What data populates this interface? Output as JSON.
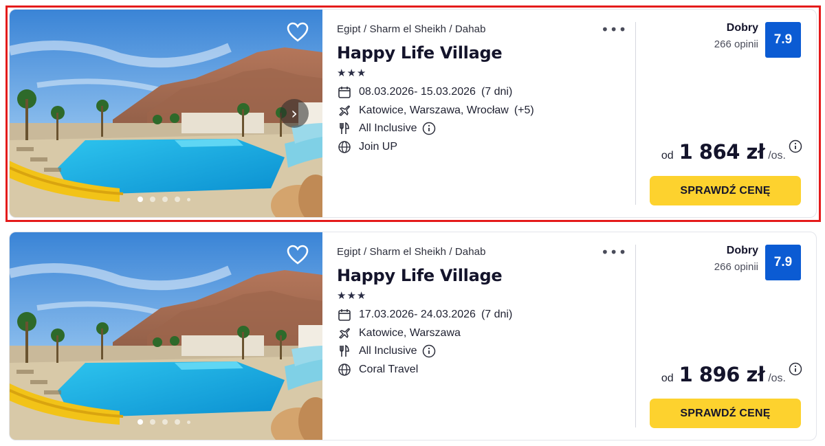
{
  "offers": [
    {
      "location": "Egipt / Sharm el Sheikh / Dahab",
      "hotel_name": "Happy Life Village",
      "stars": "★★★",
      "dates": "08.03.2026- 15.03.2026",
      "duration": "(7 dni)",
      "departures": "Katowice, Warszawa, Wrocław",
      "departures_extra": "(+5)",
      "board": "All Inclusive",
      "operator": "Join UP",
      "rating_label": "Dobry",
      "review_count": "266 opinii",
      "score": "7.9",
      "price_prefix": "od",
      "price": "1 864 zł",
      "price_suffix": "/os.",
      "cta_label": "SPRAWDŹ CENĘ",
      "more_label": "•••",
      "next_label": "›",
      "highlighted": true
    },
    {
      "location": "Egipt / Sharm el Sheikh / Dahab",
      "hotel_name": "Happy Life Village",
      "stars": "★★★",
      "dates": "17.03.2026- 24.03.2026",
      "duration": "(7 dni)",
      "departures": "Katowice, Warszawa",
      "departures_extra": "",
      "board": "All Inclusive",
      "operator": "Coral Travel",
      "rating_label": "Dobry",
      "review_count": "266 opinii",
      "score": "7.9",
      "price_prefix": "od",
      "price": "1 896 zł",
      "price_suffix": "/os.",
      "cta_label": "SPRAWDŹ CENĘ",
      "more_label": "•••",
      "highlighted": false
    }
  ],
  "icons": {
    "favorite": "heart-icon",
    "next": "chevron-right-icon",
    "more": "more-horizontal-icon",
    "dates": "calendar-icon",
    "departures": "plane-icon",
    "board": "cutlery-icon",
    "operator": "globe-icon",
    "info": "info-icon"
  },
  "colors": {
    "score_bg": "#0b5bd3",
    "cta_bg": "#fdd22e",
    "highlight_border": "#e41b1b"
  }
}
